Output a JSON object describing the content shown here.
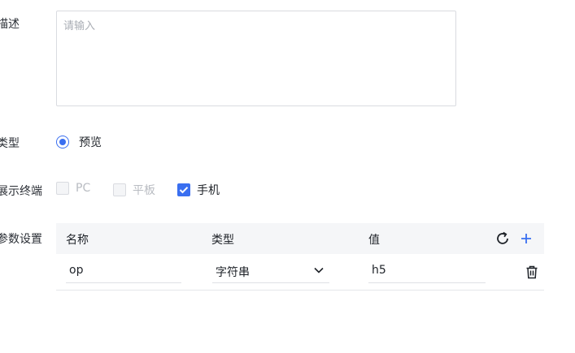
{
  "form": {
    "description": {
      "label": "描述",
      "placeholder": "请输入"
    },
    "type": {
      "label": "类型",
      "option": "预览"
    },
    "terminals": {
      "label": "展示终端",
      "options": [
        {
          "label": "PC",
          "checked": false,
          "disabled": true
        },
        {
          "label": "平板",
          "checked": false,
          "disabled": true
        },
        {
          "label": "手机",
          "checked": true,
          "disabled": false
        }
      ]
    },
    "params": {
      "label": "参数设置",
      "headers": {
        "name": "名称",
        "type": "类型",
        "value": "值"
      },
      "rows": [
        {
          "name": "op",
          "type": "字符串",
          "value": "h5"
        }
      ]
    }
  },
  "colors": {
    "accent": "#3a6ff0",
    "border": "#d9dbe0",
    "header_bg": "#f5f6f8"
  },
  "icons": [
    "refresh-icon",
    "plus-icon",
    "chevron-down-icon",
    "trash-icon",
    "check-icon"
  ]
}
